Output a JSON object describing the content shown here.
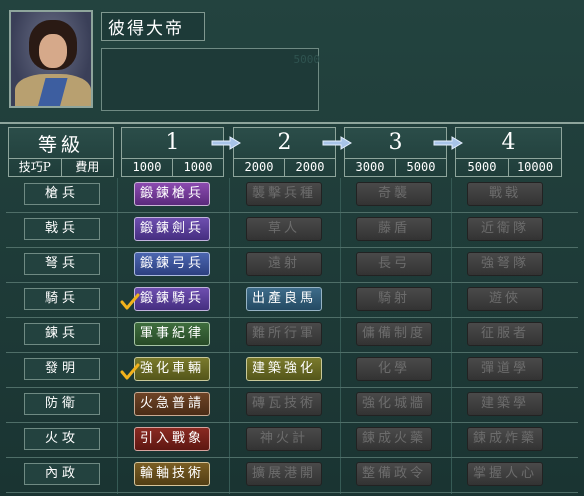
{
  "ruler": {
    "name": "彼得大帝",
    "info_faint": "5000"
  },
  "header": {
    "level_title": "等級",
    "skill_label": "技巧P",
    "fee_label": "費用",
    "tiers": [
      {
        "num": "1",
        "skill": "1000",
        "fee": "1000"
      },
      {
        "num": "2",
        "skill": "2000",
        "fee": "2000"
      },
      {
        "num": "3",
        "skill": "3000",
        "fee": "5000"
      },
      {
        "num": "4",
        "skill": "5000",
        "fee": "10000"
      }
    ]
  },
  "rows": [
    {
      "label": "槍兵",
      "techs": [
        "鍛鍊槍兵",
        "襲擊兵種",
        "奇襲",
        "戰戟"
      ],
      "learned": false
    },
    {
      "label": "戟兵",
      "techs": [
        "鍛鍊劍兵",
        "草人",
        "藤盾",
        "近衛隊"
      ],
      "learned": false
    },
    {
      "label": "弩兵",
      "techs": [
        "鍛鍊弓兵",
        "遠射",
        "長弓",
        "強弩隊"
      ],
      "learned": false
    },
    {
      "label": "騎兵",
      "techs": [
        "鍛鍊騎兵",
        "出產良馬",
        "騎射",
        "遊俠"
      ],
      "learned": true
    },
    {
      "label": "鍊兵",
      "techs": [
        "軍事紀律",
        "難所行軍",
        "傭備制度",
        "征服者"
      ],
      "learned": false
    },
    {
      "label": "發明",
      "techs": [
        "強化車輛",
        "建築強化",
        "化學",
        "彈道學"
      ],
      "learned": true
    },
    {
      "label": "防衛",
      "techs": [
        "火急普請",
        "磚瓦技術",
        "強化城牆",
        "建築學"
      ],
      "learned": false
    },
    {
      "label": "火攻",
      "techs": [
        "引入戰象",
        "神火計",
        "鍊成火藥",
        "鍊成炸藥"
      ],
      "learned": false
    },
    {
      "label": "內政",
      "techs": [
        "輪軸技術",
        "擴展港開",
        "整備政令",
        "掌握人心"
      ],
      "learned": false
    }
  ],
  "colors": {
    "row_buttons_tier1": [
      "purple",
      "violet",
      "blue",
      "violet",
      "green",
      "olive",
      "brown",
      "red",
      "gold"
    ],
    "tier2_active": [
      3,
      5
    ],
    "accent_check": "#f2b21c"
  }
}
